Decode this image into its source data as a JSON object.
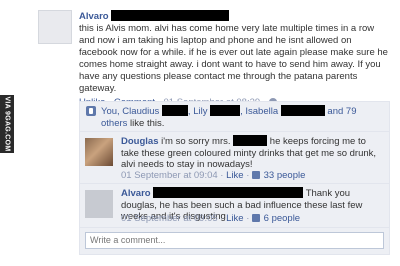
{
  "watermark": "VIA 9GAG.COM",
  "post": {
    "author": "Alvaro",
    "text": "this is Alvis mom. alvi has come home very late multiple times in a row and now i am taking his laptop and phone and he isnt allowed on facebook now for a while. if he is ever out late again please make sure he comes home straight away. i dont want to have to send him away. If you have any questions please contact me through the patana parents gateway.",
    "unlike": "Unlike",
    "comment": "Comment",
    "timestamp": "01 September at 08:39",
    "sep": "·"
  },
  "likes": {
    "you": "You, Claudius",
    "lily": ", Lily",
    "isabella": ", Isabella",
    "and": "and 79",
    "others": "others",
    "tail": "like this."
  },
  "comments": [
    {
      "author": "Douglas",
      "text_a": "i'm so sorry mrs.",
      "text_b": "he keeps forcing me to take these green coloured minty drinks that get me so drunk, alvi needs to stay in nowadays!",
      "timestamp": "01 September at 09:04",
      "like": "Like",
      "count": "33 people"
    },
    {
      "author": "Alvaro",
      "text_b": "Thank you douglas, he has been such a bad influence these last few weeks and it's disgusting",
      "timestamp": "01 September at 09:05",
      "like": "Like",
      "count": "6 people"
    }
  ],
  "composer": {
    "placeholder": "Write a comment..."
  }
}
